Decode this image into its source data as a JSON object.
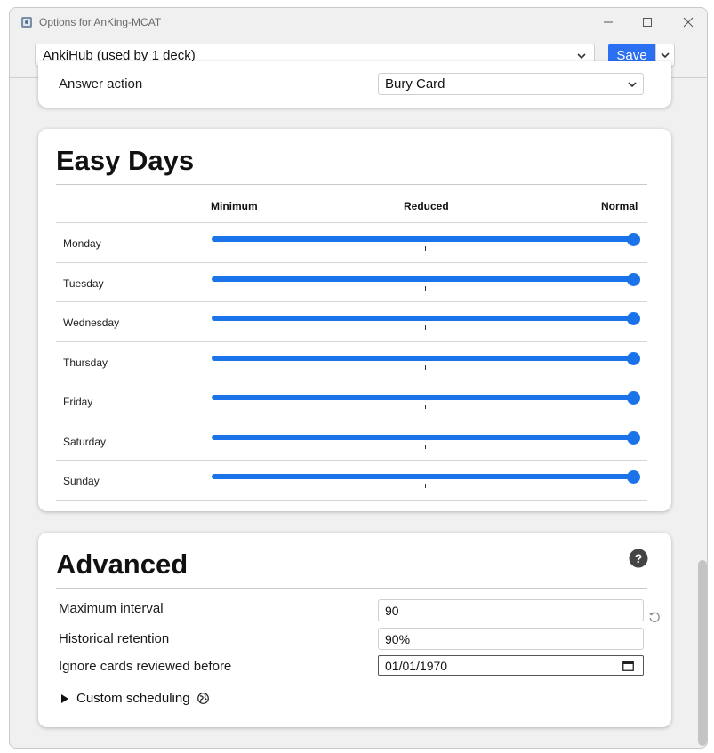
{
  "window": {
    "title": "Options for AnKing-MCAT",
    "icon": "anki-app-icon",
    "controls": [
      "minimize-icon",
      "maximize-icon",
      "close-icon"
    ]
  },
  "toolbar": {
    "preset_value": "AnkiHub (used by 1 deck)",
    "save_label": "Save"
  },
  "bury": {
    "label": "Answer action",
    "value": "Bury Card"
  },
  "easy_days": {
    "title": "Easy Days",
    "columns": [
      "Minimum",
      "Reduced",
      "Normal"
    ],
    "days": [
      {
        "label": "Monday",
        "value": 1.0
      },
      {
        "label": "Tuesday",
        "value": 1.0
      },
      {
        "label": "Wednesday",
        "value": 1.0
      },
      {
        "label": "Thursday",
        "value": 1.0
      },
      {
        "label": "Friday",
        "value": 1.0
      },
      {
        "label": "Saturday",
        "value": 1.0
      },
      {
        "label": "Sunday",
        "value": 1.0
      }
    ]
  },
  "advanced": {
    "title": "Advanced",
    "max_interval_label": "Maximum interval",
    "max_interval_value": "90",
    "historical_retention_label": "Historical retention",
    "historical_retention_value": "90%",
    "ignore_before_label": "Ignore cards reviewed before",
    "ignore_before_value": "01/01/1970",
    "custom_scheduling_label": "Custom scheduling"
  },
  "colors": {
    "accent": "#2b6ff2",
    "slider": "#1a73e8"
  }
}
